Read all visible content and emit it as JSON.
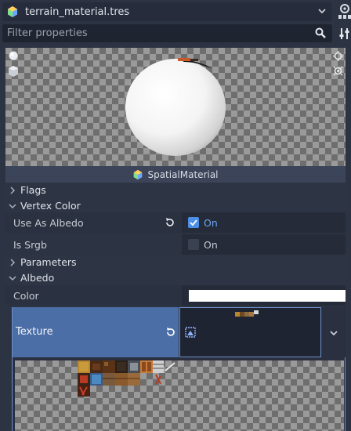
{
  "resource": {
    "name": "terrain_material.tres",
    "icon": "material-icon",
    "dropdown_icon": "chevron-down-icon",
    "docs_icon": "docs-icon"
  },
  "filter": {
    "placeholder": "Filter properties",
    "value": "",
    "search_icon": "search-icon",
    "options_icon": "filter-options-icon"
  },
  "preview": {
    "light_toggles": [
      "light1-icon",
      "light2-icon"
    ],
    "shape_buttons": [
      "sphere-icon",
      "box-icon"
    ]
  },
  "class_header": {
    "icon": "spatial-material-icon",
    "label": "SpatialMaterial"
  },
  "sections": {
    "flags": {
      "label": "Flags",
      "expanded": false
    },
    "vertex_color": {
      "label": "Vertex Color",
      "expanded": true
    },
    "parameters": {
      "label": "Parameters",
      "expanded": false
    },
    "albedo": {
      "label": "Albedo",
      "expanded": true
    }
  },
  "properties": {
    "use_as_albedo": {
      "label": "Use As Albedo",
      "checked": true,
      "value_label": "On"
    },
    "is_srgb": {
      "label": "Is Srgb",
      "checked": false,
      "value_label": "On"
    },
    "color": {
      "label": "Color",
      "value": "#ffffff"
    },
    "texture": {
      "label": "Texture"
    }
  },
  "colors": {
    "accent": "#4c8fe8",
    "selected_row": "#4b6ea6",
    "panel_bg": "#2c3342"
  }
}
